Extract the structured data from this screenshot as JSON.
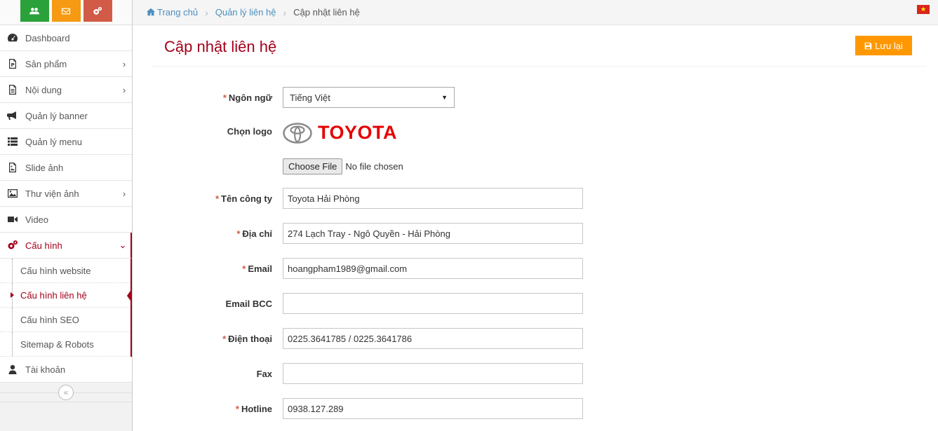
{
  "breadcrumb": {
    "home": "Trang chủ",
    "parent": "Quản lý liên hệ",
    "current": "Cập nhật liên hệ"
  },
  "sidebar": {
    "items": [
      {
        "label": "Dashboard",
        "icon": "dashboard-icon"
      },
      {
        "label": "Sản phẩm",
        "icon": "product-icon"
      },
      {
        "label": "Nội dung",
        "icon": "document-icon"
      },
      {
        "label": "Quản lý banner",
        "icon": "bullhorn-icon"
      },
      {
        "label": "Quản lý menu",
        "icon": "list-icon"
      },
      {
        "label": "Slide ảnh",
        "icon": "image-file-icon"
      },
      {
        "label": "Thư viện ảnh",
        "icon": "picture-icon"
      },
      {
        "label": "Video",
        "icon": "video-camera-icon"
      },
      {
        "label": "Cấu hình",
        "icon": "cogs-icon"
      },
      {
        "label": "Tài khoản",
        "icon": "user-icon"
      }
    ],
    "submenu": [
      {
        "label": "Cấu hình website"
      },
      {
        "label": "Cấu hình liên hệ"
      },
      {
        "label": "Cấu hình SEO"
      },
      {
        "label": "Sitemap & Robots"
      }
    ],
    "collapse": "«"
  },
  "page": {
    "title": "Cập nhật liên hệ",
    "save_label": "Lưu lại"
  },
  "form": {
    "language": {
      "label": "Ngôn ngữ",
      "value": "Tiếng Việt"
    },
    "logo": {
      "label": "Chọn logo",
      "logo_text": "TOYOTA",
      "file_button": "Choose File",
      "file_status": "No file chosen"
    },
    "company": {
      "label": "Tên công ty",
      "value": "Toyota Hải Phòng"
    },
    "address": {
      "label": "Địa chỉ",
      "value": "274 Lạch Tray - Ngô Quyền - Hải Phòng"
    },
    "email": {
      "label": "Email",
      "value": "hoangpham1989@gmail.com"
    },
    "email_bcc": {
      "label": "Email BCC",
      "value": ""
    },
    "phone": {
      "label": "Điện thoại",
      "value": "0225.3641785 / 0225.3641786"
    },
    "fax": {
      "label": "Fax",
      "value": ""
    },
    "hotline": {
      "label": "Hotline",
      "value": "0938.127.289"
    },
    "required_mark": "*"
  },
  "colors": {
    "accent": "#a3001a",
    "save_button": "#ff9800",
    "link": "#4c8fbd",
    "shortcut_green": "#2aa13a",
    "shortcut_orange": "#f59a12",
    "shortcut_red": "#d15b47"
  }
}
